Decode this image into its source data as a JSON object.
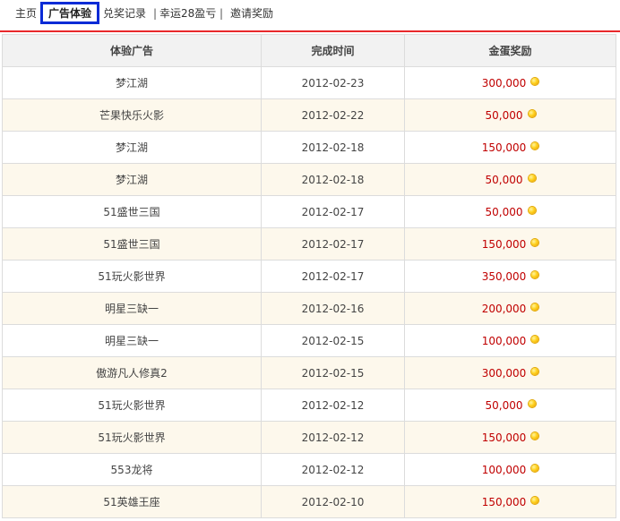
{
  "nav": {
    "home": "主页",
    "active": "广告体验",
    "redeem": "兑奖记录",
    "lucky": "幸运28盈亏",
    "invite": "邀请奖励",
    "sep": "|"
  },
  "table": {
    "headers": [
      "体验广告",
      "完成时间",
      "金蛋奖励"
    ],
    "rows": [
      {
        "ad": "梦江湖",
        "date": "2012-02-23",
        "reward": "300,000"
      },
      {
        "ad": "芒果快乐火影",
        "date": "2012-02-22",
        "reward": "50,000"
      },
      {
        "ad": "梦江湖",
        "date": "2012-02-18",
        "reward": "150,000"
      },
      {
        "ad": "梦江湖",
        "date": "2012-02-18",
        "reward": "50,000"
      },
      {
        "ad": "51盛世三国",
        "date": "2012-02-17",
        "reward": "50,000"
      },
      {
        "ad": "51盛世三国",
        "date": "2012-02-17",
        "reward": "150,000"
      },
      {
        "ad": "51玩火影世界",
        "date": "2012-02-17",
        "reward": "350,000"
      },
      {
        "ad": "明星三缺一",
        "date": "2012-02-16",
        "reward": "200,000"
      },
      {
        "ad": "明星三缺一",
        "date": "2012-02-15",
        "reward": "100,000"
      },
      {
        "ad": "傲游凡人修真2",
        "date": "2012-02-15",
        "reward": "300,000"
      },
      {
        "ad": "51玩火影世界",
        "date": "2012-02-12",
        "reward": "50,000"
      },
      {
        "ad": "51玩火影世界",
        "date": "2012-02-12",
        "reward": "150,000"
      },
      {
        "ad": "553龙将",
        "date": "2012-02-12",
        "reward": "100,000"
      },
      {
        "ad": "51英雄王座",
        "date": "2012-02-10",
        "reward": "150,000"
      }
    ]
  },
  "colors": {
    "accent_red": "#e8282b",
    "reward_red": "#c00000",
    "highlight_blue": "#0a2bd6",
    "row_alt": "#fdf8ec",
    "header_bg": "#f2f2f2"
  },
  "icons": {
    "reward_icon": "gold-egg-icon"
  }
}
